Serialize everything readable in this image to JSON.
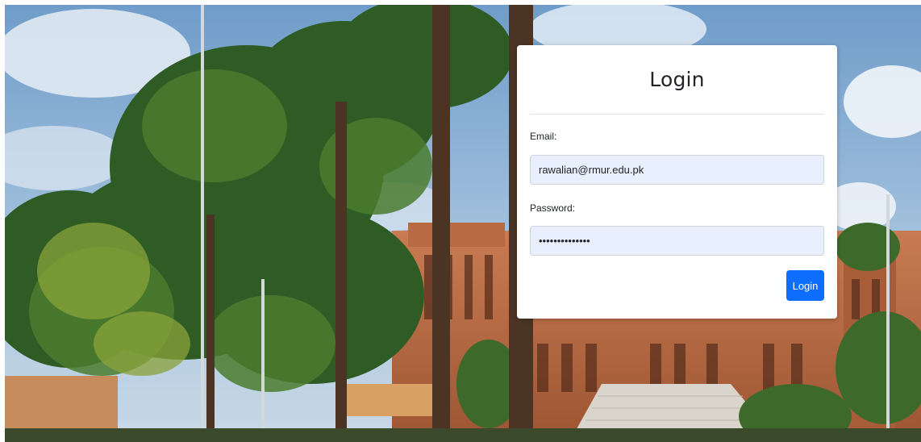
{
  "login_card": {
    "title": "Login",
    "email_label": "Email:",
    "email_value": "rawalian@rmur.edu.pk",
    "password_label": "Password:",
    "password_value": "••••••••••••••",
    "submit_label": "Login"
  },
  "background": {
    "scene": "campus-photo",
    "colors": {
      "sky": "#8fb6d8",
      "brick": "#b5673f",
      "foliage": "#2f5b25"
    }
  }
}
